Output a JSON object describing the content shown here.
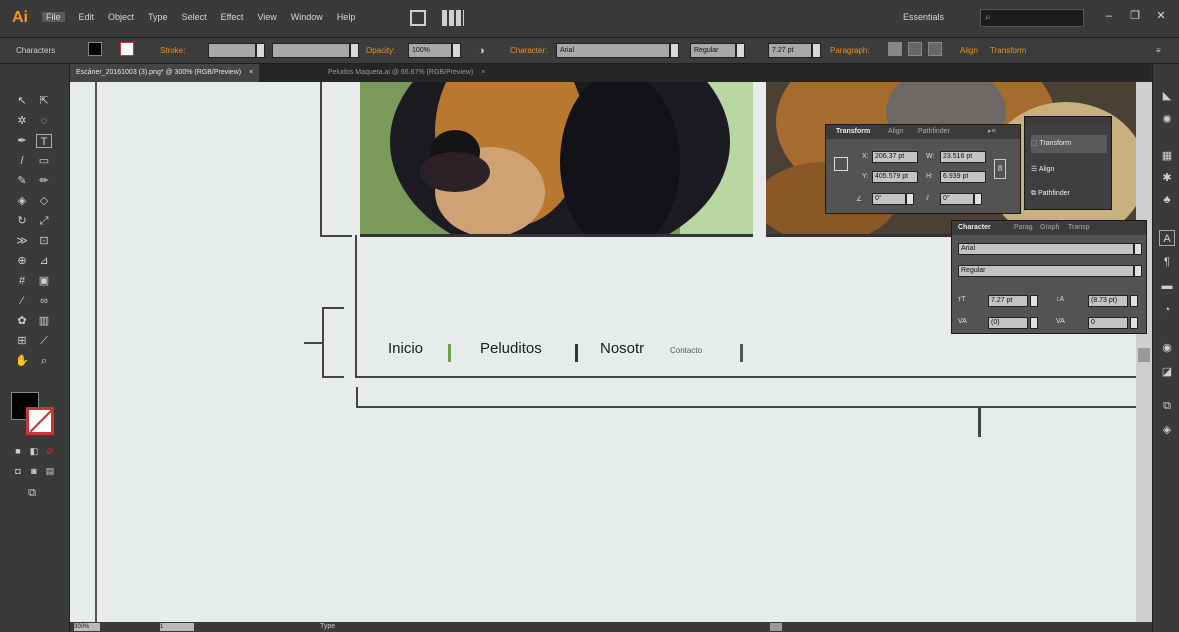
{
  "app": {
    "logo": "Ai"
  },
  "menu": [
    "File",
    "Edit",
    "Object",
    "Type",
    "Select",
    "Effect",
    "View",
    "Window",
    "Help"
  ],
  "workspace": {
    "label": "Essentials",
    "search_placeholder": ""
  },
  "window_controls": {
    "minimize": "–",
    "restore": "❐",
    "close": "✕"
  },
  "control_bar": {
    "panel_label": "Characters",
    "stroke_label": "Stroke:",
    "opacity_label": "Opacity:",
    "opacity_value": "100%",
    "character_label": "Character:",
    "font_value": "Arial",
    "style_value": "Regular",
    "size_value": "7.27 pt",
    "paragraph_label": "Paragraph:",
    "align_label": "Align",
    "transform_label": "Transform"
  },
  "tabs": [
    {
      "label": "Escáner_20161003 (3).png* @ 300% (RGB/Preview)",
      "close": "×"
    },
    {
      "label": "Peludos Maqueta.ai @ 66.67% (RGB/Preview)",
      "close": "×"
    }
  ],
  "canvas": {
    "nav_items": [
      "Inicio",
      "Peluditos",
      "Nosotr"
    ],
    "scribble_item": "Contacto"
  },
  "transform_panel": {
    "tabs": [
      "Transform",
      "Align",
      "Pathfinder"
    ],
    "x_label": "X:",
    "x_value": "206.37 pt",
    "w_label": "W:",
    "w_value": "23.516 pt",
    "y_label": "Y:",
    "y_value": "405.579 pt",
    "h_label": "H:",
    "h_value": "6.939 pt",
    "rotate_value": "0°",
    "shear_value": "0°"
  },
  "mini_panel": {
    "items": [
      "Transform",
      "Align",
      "Pathfinder"
    ]
  },
  "character_panel": {
    "tabs": [
      "Character",
      "Parag",
      "Graph",
      "Transp"
    ],
    "font": "Arial",
    "style": "Regular",
    "size": "7.27 pt",
    "leading": "(8.73 pt)",
    "kerning": "(0)",
    "tracking": "0"
  },
  "status_bar": {
    "zoom": "300%",
    "page": "1",
    "tool": "Type"
  },
  "colors": {
    "accent_orange": "#f7941d",
    "canvas_bg": "#e8ebec",
    "ui_dark": "#3a3a3a"
  }
}
